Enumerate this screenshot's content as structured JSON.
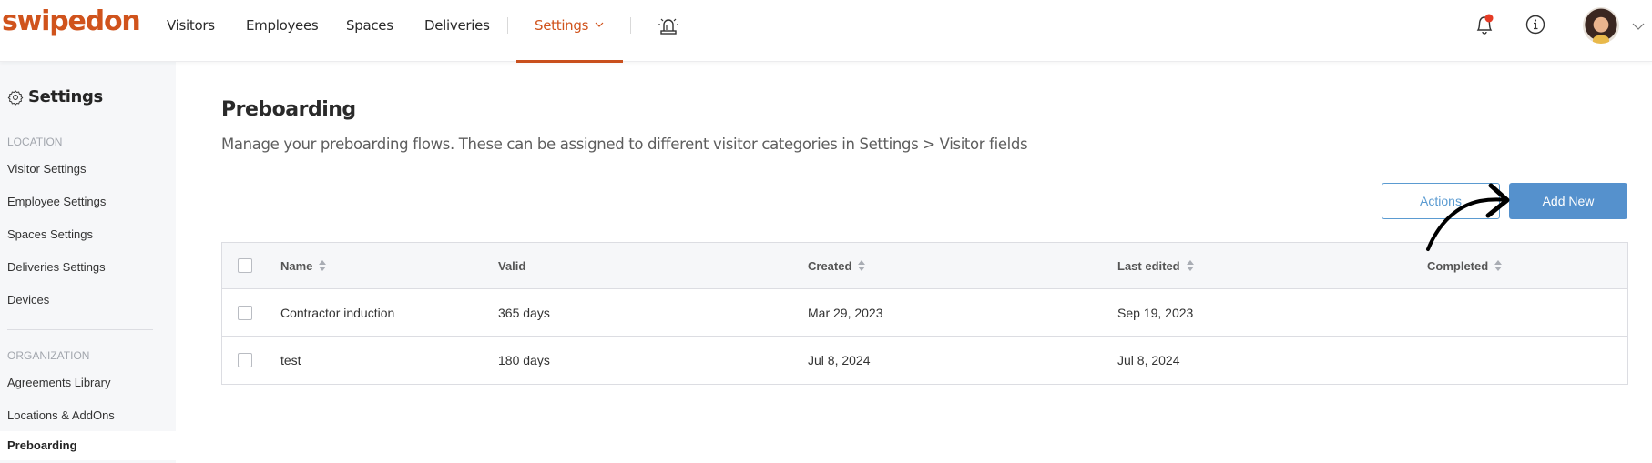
{
  "header": {
    "logo": "swipedon",
    "nav": [
      {
        "label": "Visitors",
        "active": false
      },
      {
        "label": "Employees",
        "active": false
      },
      {
        "label": "Spaces",
        "active": false
      },
      {
        "label": "Deliveries",
        "active": false
      },
      {
        "label": "Settings",
        "active": true
      }
    ],
    "icons": [
      "emergency-alarm-icon",
      "bell-icon",
      "info-icon",
      "avatar",
      "chevron-down-icon"
    ],
    "notification_dot": true,
    "colors": {
      "brand": "#d0531c",
      "notification": "#e53b25"
    }
  },
  "sidebar": {
    "title": "Settings",
    "sections": [
      {
        "heading": "LOCATION",
        "items": [
          "Visitor Settings",
          "Employee Settings",
          "Spaces Settings",
          "Deliveries Settings",
          "Devices"
        ]
      },
      {
        "heading": "ORGANIZATION",
        "items": [
          "Agreements Library",
          "Locations & AddOns",
          "Preboarding"
        ]
      }
    ],
    "active_item": "Preboarding"
  },
  "main": {
    "title": "Preboarding",
    "description": "Manage your preboarding flows. These can be assigned to different visitor categories in Settings > Visitor fields",
    "buttons": {
      "actions": "Actions",
      "add_new": "Add New"
    },
    "colors": {
      "primary": "#5591cd"
    },
    "table": {
      "columns": [
        {
          "label": "Name",
          "sortable": true
        },
        {
          "label": "Valid",
          "sortable": false
        },
        {
          "label": "Created",
          "sortable": true
        },
        {
          "label": "Last edited",
          "sortable": true
        },
        {
          "label": "Completed",
          "sortable": true
        }
      ],
      "rows": [
        {
          "name": "Contractor induction",
          "valid": "365 days",
          "created": "Mar 29, 2023",
          "last_edited": "Sep 19, 2023",
          "completed": ""
        },
        {
          "name": "test",
          "valid": "180 days",
          "created": "Jul 8, 2024",
          "last_edited": "Jul 8, 2024",
          "completed": ""
        }
      ]
    }
  },
  "annotation": {
    "type": "hand-drawn-arrow",
    "points_to": "Add New"
  }
}
